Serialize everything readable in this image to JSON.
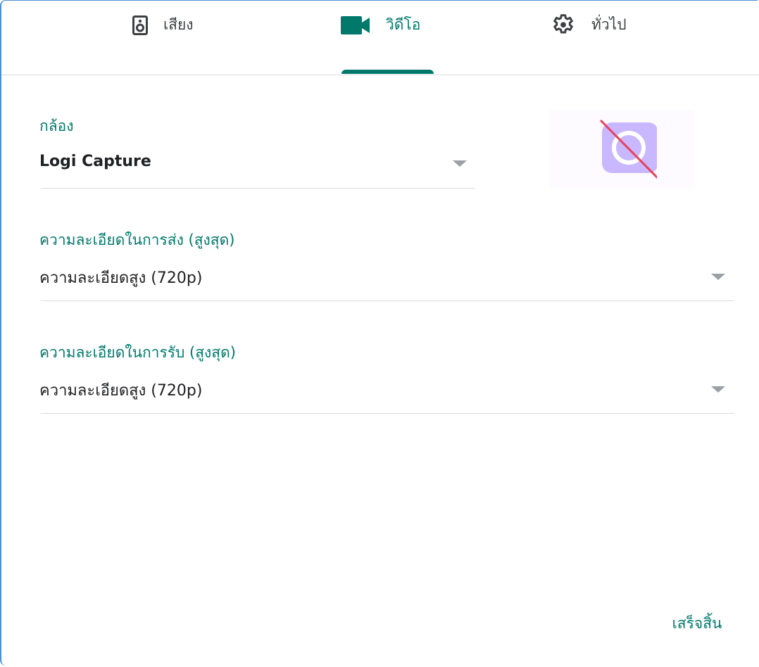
{
  "tabs": [
    {
      "label": "เสียง",
      "icon": "speaker-icon",
      "active": false
    },
    {
      "label": "วิดีโอ",
      "icon": "videocam-icon",
      "active": true
    },
    {
      "label": "ทั่วไป",
      "icon": "gear-icon",
      "active": false
    }
  ],
  "camera": {
    "label": "กล้อง",
    "value": "Logi Capture",
    "preview_icon": "camera-off-icon"
  },
  "send_resolution": {
    "label": "ความละเอียดในการส่ง (สูงสุด)",
    "value": "ความละเอียดสูง (720p)"
  },
  "receive_resolution": {
    "label": "ความละเอียดในการรับ (สูงสุด)",
    "value": "ความละเอียดสูง (720p)"
  },
  "done_label": "เสร็จสิ้น",
  "colors": {
    "accent": "#00796b",
    "divider": "#dadce0",
    "text": "#202124",
    "preview_tile": "#c9b8ff",
    "strike": "#e8425a"
  }
}
